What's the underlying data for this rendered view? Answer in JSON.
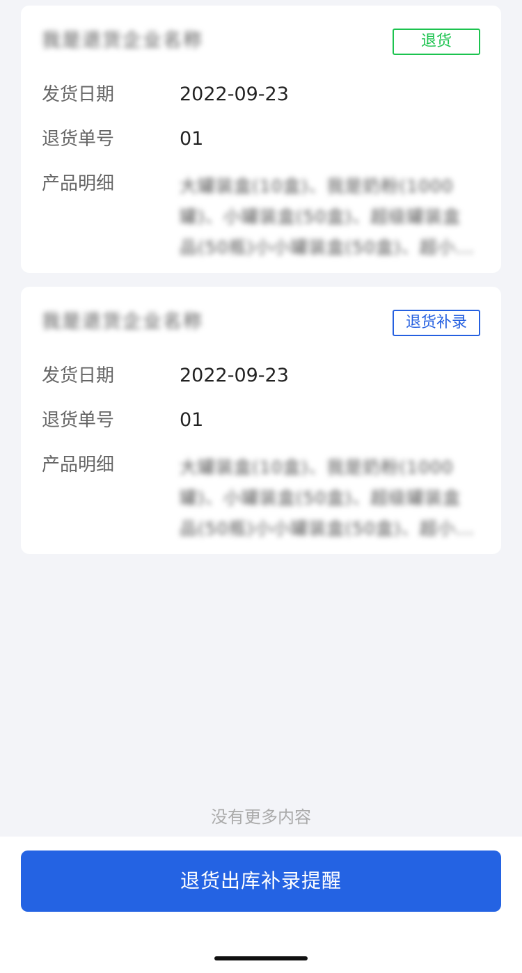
{
  "labels": {
    "ship_date": "发货日期",
    "return_no": "退货单号",
    "product_detail": "产品明细"
  },
  "cards": [
    {
      "company": "我是退货企业名称",
      "tag": "退货",
      "tag_color": "#1cc34f",
      "ship_date": "2022-09-23",
      "return_no": "01",
      "detail": "大罐装盒(10盒)、我是奶粉(1000罐)、小罐装盒(50盒)、超级罐装盒品(50瓶)小小罐装盒(50盒)、超小..."
    },
    {
      "company": "我是退货企业名称",
      "tag": "退货补录",
      "tag_color": "#2560e0",
      "ship_date": "2022-09-23",
      "return_no": "01",
      "detail": "大罐装盒(10盒)、我是奶粉(1000罐)、小罐装盒(50盒)、超级罐装盒品(50瓶)小小罐装盒(50盒)、超小..."
    }
  ],
  "list_end_text": "没有更多内容",
  "footer": {
    "button_label": "退货出库补录提醒",
    "button_color": "#2463e3"
  }
}
